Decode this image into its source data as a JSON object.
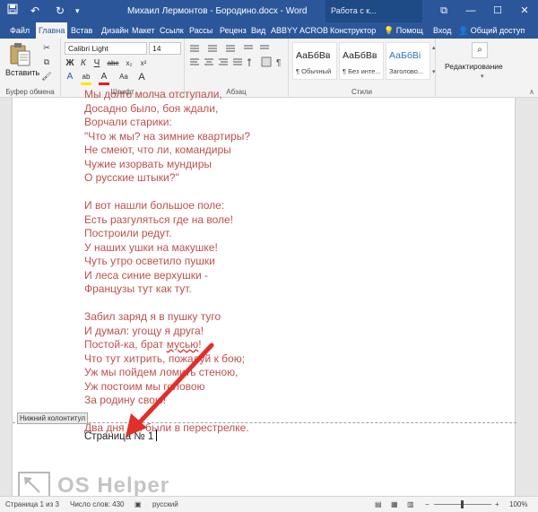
{
  "titlebar": {
    "title": "Михаил Лермонтов - Бородино.docx  -  Word",
    "contextual_tab_group": "Работа с к...",
    "window_buttons": {
      "restore": "⧉",
      "minimize": "—",
      "maximize": "☐",
      "close": "✕"
    },
    "quick_access": {
      "save": "💾",
      "undo": "↶",
      "redo": "↻",
      "customize": "▾"
    }
  },
  "tabs": [
    "Файл",
    "Главна",
    "Встав",
    "Дизайн",
    "Макет",
    "Ссылк",
    "Рассы",
    "Реценз",
    "Вид",
    "ABBYY",
    "ACROB",
    "Конструктор"
  ],
  "active_tab": "Главна",
  "tell_me": "Помощ",
  "sign_in": "Вход",
  "share": "Общий доступ",
  "ribbon": {
    "clipboard": {
      "paste_label": "Вставить",
      "group_label": "Буфер обмена"
    },
    "font": {
      "font_name": "Calibri Light",
      "font_size": "14",
      "group_label": "Шрифт",
      "buttons": [
        "Ж",
        "К",
        "Ч",
        "abc",
        "x₂",
        "x²"
      ],
      "color_buttons": [
        "A",
        "ab",
        "A",
        "Aa",
        "A"
      ]
    },
    "paragraph": {
      "group_label": "Абзац"
    },
    "styles": {
      "group_label": "Стили",
      "items": [
        {
          "sample": "АаБбВв",
          "name": "¶ Обычный"
        },
        {
          "sample": "АаБбВв",
          "name": "¶ Без инте..."
        },
        {
          "sample": "АаБбВі",
          "name": "Заголово..."
        }
      ]
    },
    "editing": {
      "label": "Редактирование"
    }
  },
  "document": {
    "accent_color": "#c0504d",
    "poem_lines": [
      "Мы долго молча отступали,",
      "Досадно было, боя ждали,",
      "Ворчали старики:",
      "\"Что ж мы? на зимние квартиры?",
      "Не смеют, что ли, командиры",
      "Чужие изорвать мундиры",
      "О русские штыки?\"",
      "",
      "И вот нашли большое поле:",
      "Есть разгуляться где на воле!",
      "Построили редут.",
      "У наших ушки на макушке!",
      "Чуть утро осветило пушки",
      "И леса синие верхушки -",
      "Французы тут как тут.",
      "",
      "Забил заряд я в пушку туго",
      "И думал: угощу я друга!",
      "Постой-ка, брат мусью!",
      "Что тут хитрить, пожалуй к бою;",
      "Уж мы пойдем ломить стеною,",
      "Уж постоим мы головою",
      "За родину свою!",
      "",
      "Два дня мы были в перестрелке."
    ],
    "footer_tag": "Нижний колонтитул",
    "footer_text": "Страница № 1"
  },
  "watermark": "OS Helper",
  "status": {
    "page": "Страница 1 из 3",
    "words": "Число слов: 430",
    "language": "русский",
    "zoom": "100%"
  }
}
